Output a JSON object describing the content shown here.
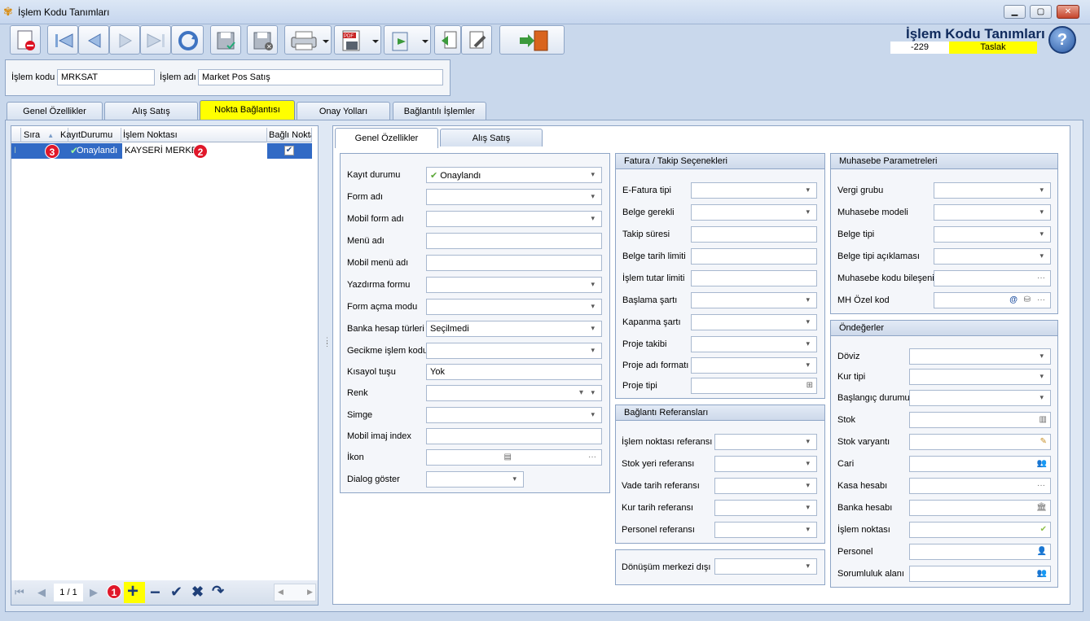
{
  "window": {
    "title": "İşlem Kodu Tanımları"
  },
  "header": {
    "title": "İşlem Kodu Tanımları",
    "number": "-229",
    "status": "Taslak",
    "status_color": "#ffff00"
  },
  "info": {
    "code_label": "İşlem kodu",
    "code_value": "MRKSAT",
    "name_label": "İşlem adı",
    "name_value": "Market Pos Satış"
  },
  "tabs": [
    "Genel Özellikler",
    "Alış Satış",
    "Nokta Bağlantısı",
    "Onay Yolları",
    "Bağlantılı İşlemler"
  ],
  "grid": {
    "columns": [
      "Sıra",
      "KayıtDurumu",
      "İşlem Noktası",
      "Bağlı Nokta"
    ],
    "rows": [
      {
        "status": "Onaylandı",
        "point": "KAYSERİ MERKEZ",
        "linked": true
      }
    ],
    "badges": [
      "3",
      "2",
      "1"
    ]
  },
  "nav": {
    "page": "1 / 1"
  },
  "inner_tabs": [
    "Genel Özellikler",
    "Alış Satış"
  ],
  "general": {
    "fields": [
      {
        "label": "Kayıt durumu",
        "value": "Onaylandı"
      },
      {
        "label": "Form adı",
        "value": ""
      },
      {
        "label": "Mobil form adı",
        "value": ""
      },
      {
        "label": "Menü adı",
        "value": ""
      },
      {
        "label": "Mobil menü adı",
        "value": ""
      },
      {
        "label": "Yazdırma formu",
        "value": ""
      },
      {
        "label": "Form açma modu",
        "value": ""
      },
      {
        "label": "Banka hesap türleri",
        "value": "Seçilmedi"
      },
      {
        "label": "Gecikme işlem kodu",
        "value": ""
      },
      {
        "label": "Kısayol tuşu",
        "value": "Yok"
      },
      {
        "label": "Renk",
        "value": ""
      },
      {
        "label": "Simge",
        "value": ""
      },
      {
        "label": "Mobil imaj index",
        "value": ""
      },
      {
        "label": "İkon",
        "value": ""
      },
      {
        "label": "Dialog göster",
        "value": ""
      }
    ]
  },
  "fatura": {
    "title": "Fatura / Takip Seçenekleri",
    "fields": [
      "E-Fatura tipi",
      "Belge gerekli",
      "Takip süresi",
      "Belge tarih limiti",
      "İşlem tutar limiti",
      "Başlama şartı",
      "Kapanma şartı",
      "Proje takibi",
      "Proje adı formatı",
      "Proje tipi"
    ]
  },
  "baglanti": {
    "title": "Bağlantı Referansları",
    "fields": [
      "İşlem noktası referansı",
      "Stok yeri referansı",
      "Vade tarih referansı",
      "Kur tarih referansı",
      "Personel referansı"
    ]
  },
  "donusum": {
    "label": "Dönüşüm merkezi dışı"
  },
  "muhasebe": {
    "title": "Muhasebe Parametreleri",
    "fields": [
      "Vergi grubu",
      "Muhasebe modeli",
      "Belge tipi",
      "Belge tipi açıklaması",
      "Muhasebe kodu bileşeni",
      "MH Özel kod"
    ]
  },
  "ondeger": {
    "title": "Öndeğerler",
    "fields": [
      "Döviz",
      "Kur tipi",
      "Başlangıç durumu",
      "Stok",
      "Stok varyantı",
      "Cari",
      "Kasa hesabı",
      "Banka hesabı",
      "İşlem noktası",
      "Personel",
      "Sorumluluk alanı"
    ]
  }
}
